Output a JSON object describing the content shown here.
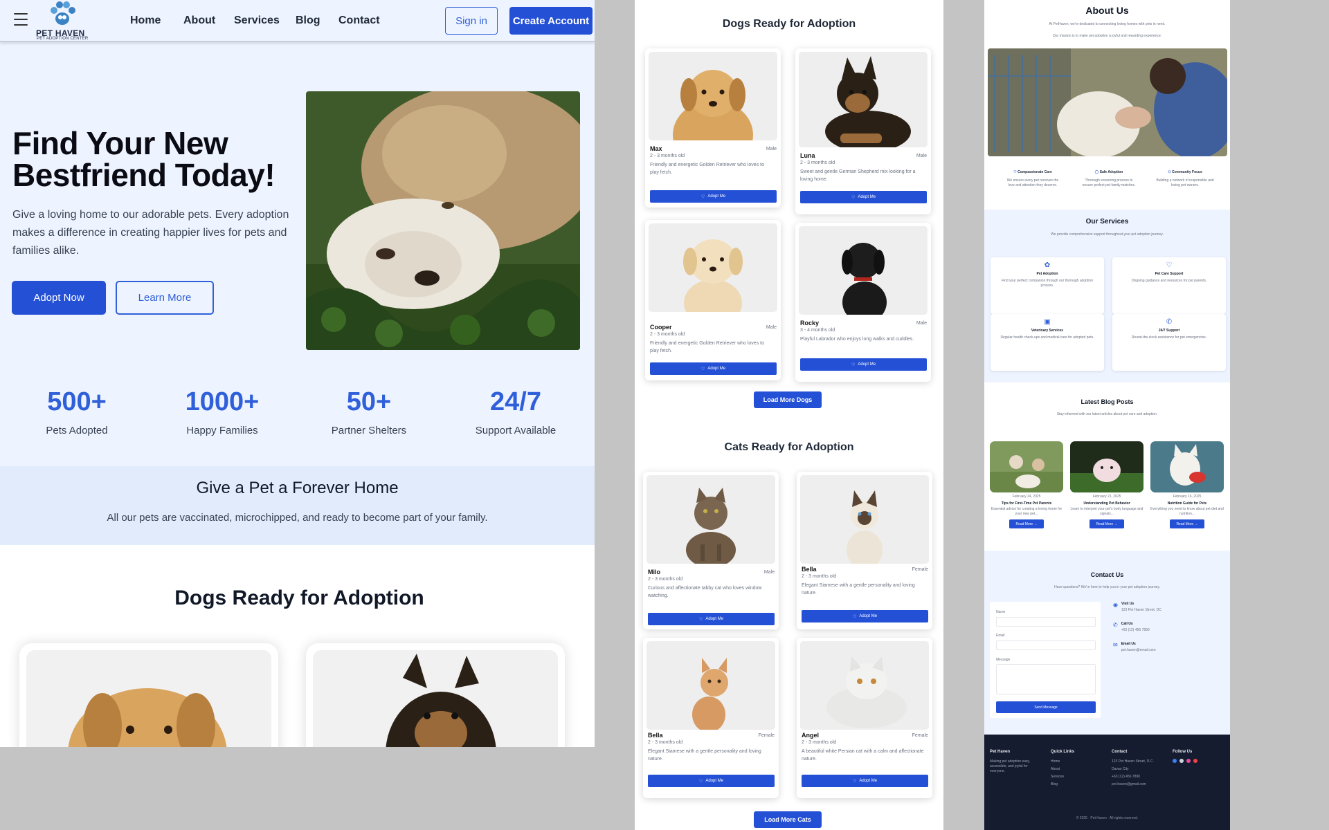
{
  "panel1": {
    "logo": {
      "title": "PET HAVEN",
      "subtitle": "PET ADOPTION CENTER"
    },
    "nav": [
      "Home",
      "About",
      "Services",
      "Blog",
      "Contact"
    ],
    "sign_in": "Sign in",
    "create_account": "Create Account",
    "hero": {
      "title_line1": "Find Your New",
      "title_line2": "Bestfriend Today!",
      "text": "Give a loving home to our adorable pets. Every adoption makes a difference in creating happier lives for pets and families alike.",
      "adopt_now": "Adopt Now",
      "learn_more": "Learn More"
    },
    "stats": [
      {
        "value": "500+",
        "label": "Pets Adopted"
      },
      {
        "value": "1000+",
        "label": "Happy Families"
      },
      {
        "value": "50+",
        "label": "Partner Shelters"
      },
      {
        "value": "24/7",
        "label": "Support Available"
      }
    ],
    "band": {
      "title": "Give a Pet a Forever Home",
      "subtitle": "All our pets are vaccinated, microchipped, and ready to become part of your family."
    },
    "dogs_title": "Dogs Ready for Adoption"
  },
  "panel2": {
    "dogs_title": "Dogs Ready for Adoption",
    "dogs": [
      {
        "name": "Max",
        "gender": "Male",
        "age": "2 - 3 months old",
        "desc": "Friendly and energetic Golden Retriever who loves to play fetch."
      },
      {
        "name": "Luna",
        "gender": "Male",
        "age": "2 - 3 months old",
        "desc": "Sweet and gentle German Shepherd mix looking for a loving home."
      },
      {
        "name": "Cooper",
        "gender": "Male",
        "age": "2 - 3 months old",
        "desc": "Friendly and energetic Golden Retriever who loves to play fetch."
      },
      {
        "name": "Rocky",
        "gender": "Male",
        "age": "3 - 4 months old",
        "desc": "Playful Labrador who enjoys long walks and cuddles."
      }
    ],
    "load_more_dogs": "Load More Dogs",
    "cats_title": "Cats Ready for Adoption",
    "cats": [
      {
        "name": "Milo",
        "gender": "Male",
        "age": "2 - 3 months old",
        "desc": "Curious and affectionate tabby cat who loves window watching."
      },
      {
        "name": "Bella",
        "gender": "Female",
        "age": "2 - 3 months old",
        "desc": "Elegant Siamese with a gentle personality and loving nature."
      },
      {
        "name": "Bella",
        "gender": "Female",
        "age": "2 - 3 months old",
        "desc": "Elegant Siamese with a gentle personality and loving nature."
      },
      {
        "name": "Angel",
        "gender": "Female",
        "age": "2 - 3 months old",
        "desc": "A beautiful white Persian cat with a calm and affectionate nature."
      }
    ],
    "adopt_me": "Adopt Me",
    "load_more_cats": "Load More Cats"
  },
  "panel3": {
    "about_title": "About Us",
    "about_p1": "At PetHaven, we're dedicated to connecting loving homes with pets in need.",
    "about_p2": "Our mission is to make pet adoption a joyful and rewarding experience.",
    "values": [
      {
        "title": "Compassionate Care",
        "text": "We ensure every pet receives the love and attention they deserve."
      },
      {
        "title": "Safe Adoption",
        "text": "Thorough screening process to ensure perfect pet-family matches."
      },
      {
        "title": "Community Focus",
        "text": "Building a network of responsible and loving pet owners."
      }
    ],
    "services_title": "Our Services",
    "services_sub": "We provide comprehensive support throughout your pet adoption journey.",
    "services": [
      {
        "title": "Pet Adoption",
        "text": "Find your perfect companion through our thorough adoption process."
      },
      {
        "title": "Pet Care Support",
        "text": "Ongoing guidance and resources for pet parents."
      },
      {
        "title": "Veterinary Services",
        "text": "Regular health check-ups and medical care for adopted pets."
      },
      {
        "title": "24/7 Support",
        "text": "Round-the-clock assistance for pet emergencies."
      }
    ],
    "blog_title": "Latest Blog Posts",
    "blog_sub": "Stay informed with our latest articles about pet care and adoption.",
    "posts": [
      {
        "date": "February 24, 2025",
        "title": "Tips for First-Time Pet Parents",
        "text": "Essential advice for creating a loving home for your new pet..."
      },
      {
        "date": "February 21, 2025",
        "title": "Understanding Pet Behavior",
        "text": "Learn to interpret your pet's body language and signals..."
      },
      {
        "date": "February 16, 2025",
        "title": "Nutrition Guide for Pets",
        "text": "Everything you need to know about pet diet and nutrition..."
      }
    ],
    "read_more": "Read More →",
    "contact_title": "Contact Us",
    "contact_sub": "Have questions? We're here to help you in your pet adoption journey.",
    "form": {
      "name": "Name",
      "email": "Email",
      "message": "Message",
      "send": "Send Message"
    },
    "contact_info": [
      {
        "label": "Visit Us",
        "value": "123 Pet Haven Street, DC"
      },
      {
        "label": "Call Us",
        "value": "+63 (12) 456 7890"
      },
      {
        "label": "Email Us",
        "value": "pet.haven@email.com"
      }
    ],
    "footer": {
      "brand": "Pet Haven",
      "brand_text": "Making pet adoption easy, accessible, and joyful for everyone.",
      "quick_links_title": "Quick Links",
      "quick_links": [
        "Home",
        "About",
        "Services",
        "Blog"
      ],
      "contact_title": "Contact",
      "contact": [
        "123 Pet Haven Street, D.C.",
        "Davao City",
        "+63 (12) 456 7890",
        "pet.haven@gmail.com"
      ],
      "follow_title": "Follow Us",
      "copyright": "© 2025 · Pet Haven · All rights reserved."
    }
  },
  "colors": {
    "primary": "#2450d6",
    "hero_bg": "#eef4ff",
    "band_bg": "#e1ebfc",
    "footer_bg": "#161c30"
  }
}
